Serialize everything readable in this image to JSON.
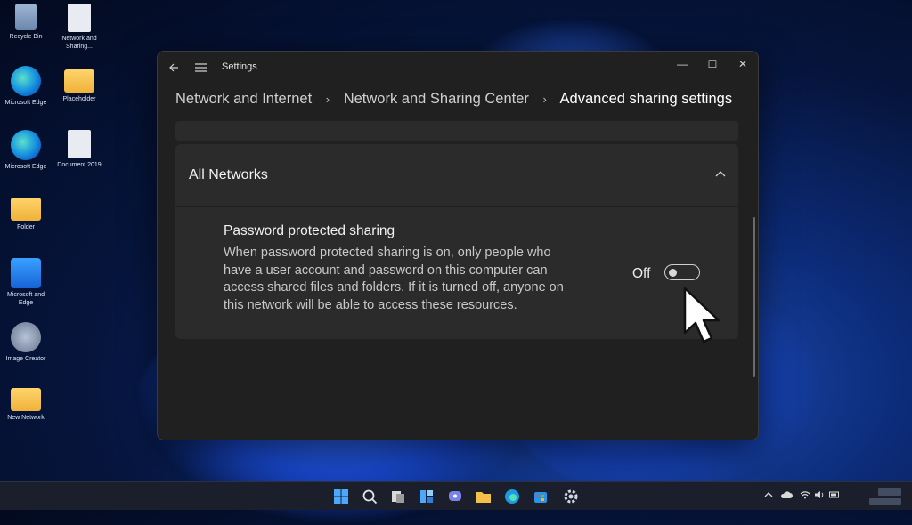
{
  "desktop": {
    "icons": [
      {
        "label": "Recycle Bin",
        "glyph": "bin"
      },
      {
        "label": "Network and Sharing...",
        "glyph": "doc"
      },
      {
        "label": "Microsoft Edge",
        "glyph": "edge"
      },
      {
        "label": "Placeholder",
        "glyph": "folder"
      },
      {
        "label": "Microsoft Edge",
        "glyph": "edge"
      },
      {
        "label": "Document 2019",
        "glyph": "doc"
      },
      {
        "label": "Folder",
        "glyph": "folder"
      },
      {
        "label": "Microsoft and Edge",
        "glyph": "app"
      },
      {
        "label": "Image Creator",
        "glyph": "tool"
      },
      {
        "label": "New Network",
        "glyph": "folder"
      }
    ]
  },
  "window": {
    "title": "Settings",
    "back_icon": "back-arrow-icon",
    "menu_icon": "hamburger-menu-icon",
    "controls": {
      "minimize": "—",
      "maximize": "☐",
      "close": "✕"
    }
  },
  "breadcrumb": {
    "items": [
      "Network and Internet",
      "Network and Sharing Center"
    ],
    "current": "Advanced sharing settings",
    "separator": "›"
  },
  "section": {
    "title": "All Networks",
    "expanded": true
  },
  "setting": {
    "title": "Password protected sharing",
    "description": "When password protected sharing is on, only people who have a user account and password on this computer can access shared files and folders. If it is turned off, anyone on this network will be able to access these resources.",
    "state_label": "Off",
    "enabled": false
  },
  "colors": {
    "window_bg": "#202020",
    "card_bg": "#2b2b2b",
    "text_primary": "#f2f2f2",
    "text_secondary": "#c8c8c8"
  },
  "taskbar": {
    "icons": [
      "start-icon",
      "search-icon",
      "task-view-icon",
      "widgets-icon",
      "chat-icon",
      "file-explorer-icon",
      "edge-icon",
      "store-icon",
      "settings-icon"
    ],
    "tray_icons": [
      "chevron-up-icon",
      "cloud-icon",
      "wifi-icon",
      "volume-icon",
      "battery-icon"
    ]
  }
}
